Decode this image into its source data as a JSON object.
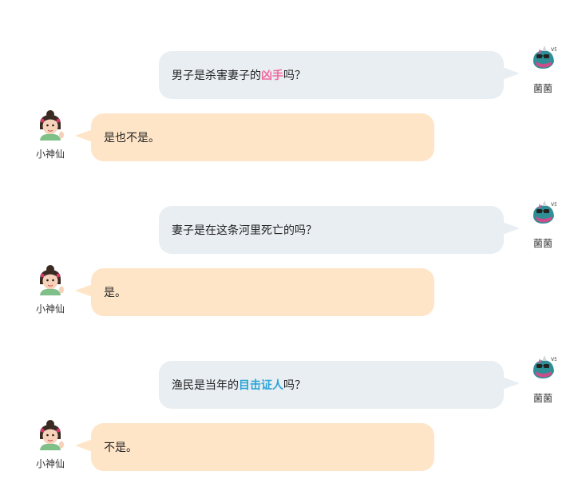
{
  "user": {
    "name": "菌菌",
    "avatar_icon": "shark-avatar-icon"
  },
  "fairy": {
    "name": "小神仙",
    "avatar_icon": "girl-avatar-icon"
  },
  "colors": {
    "question_bubble": "#e9eef2",
    "answer_bubble": "#ffe5c7",
    "highlight_pink": "#f06aa0",
    "highlight_blue": "#2aa5d8"
  },
  "exchanges": [
    {
      "question": {
        "before": "男子是杀害妻子的",
        "highlight": "凶手",
        "after": "吗？"
      },
      "answer": "是也不是。"
    },
    {
      "question": {
        "before": "妻子是在这条河里死亡的吗？",
        "highlight": "",
        "after": ""
      },
      "answer": "是。"
    },
    {
      "question": {
        "before": "渔民是当年的",
        "highlight": "目击证人",
        "after": "吗？"
      },
      "answer": "不是。"
    }
  ]
}
